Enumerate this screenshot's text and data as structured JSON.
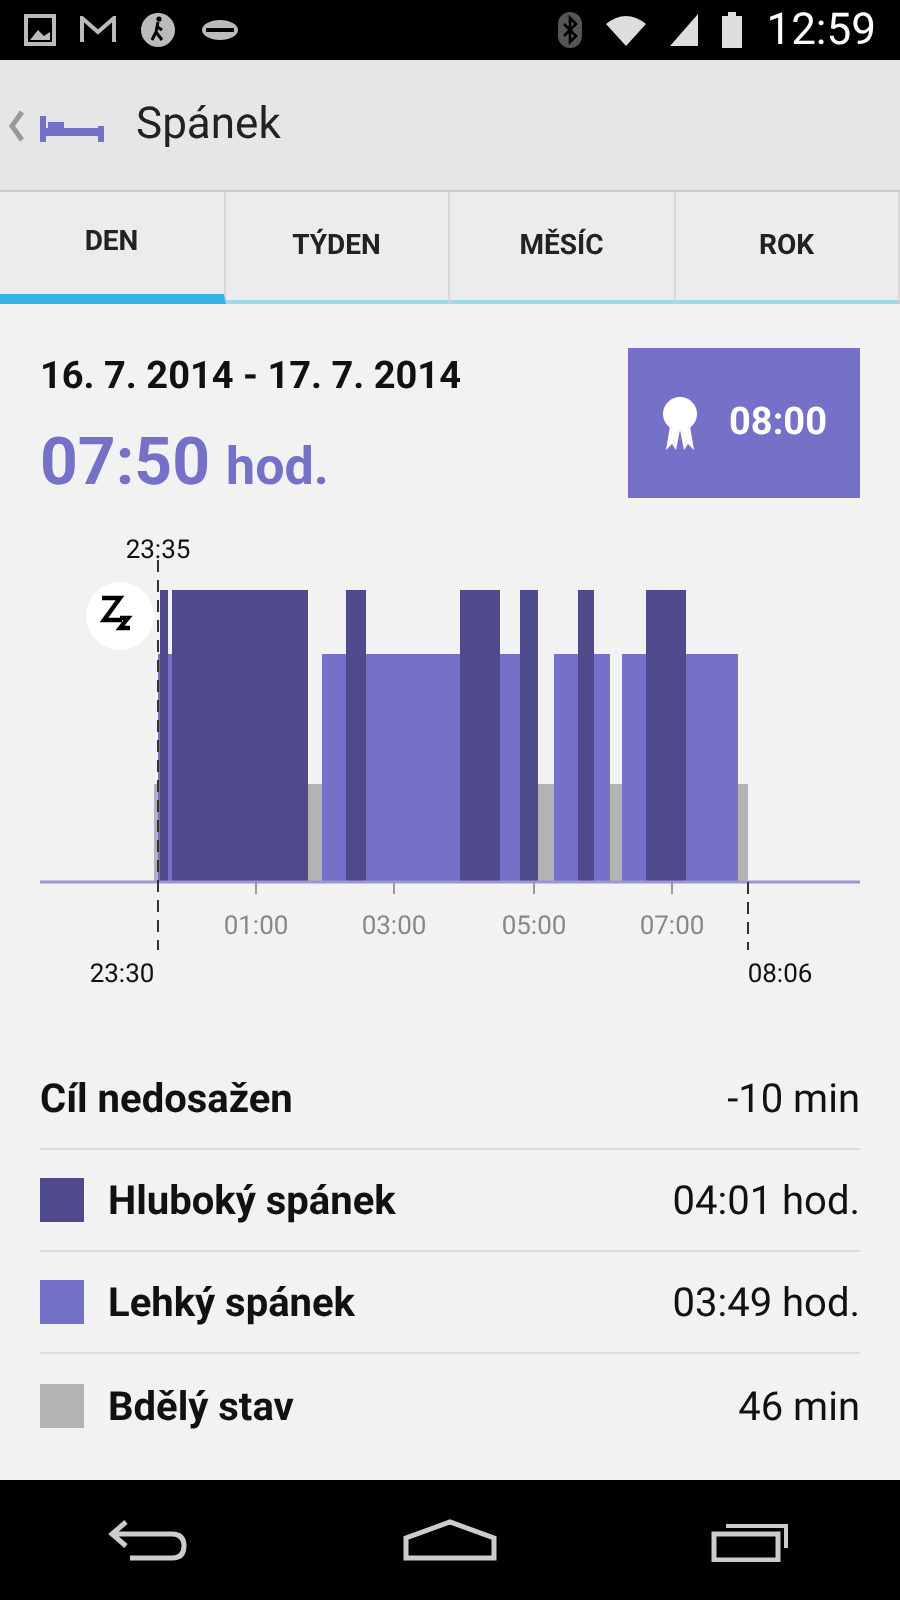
{
  "status_bar": {
    "time": "12:59"
  },
  "app_bar": {
    "title": "Spánek"
  },
  "tabs": [
    {
      "label": "DEN",
      "selected": true
    },
    {
      "label": "TÝDEN",
      "selected": false
    },
    {
      "label": "MĚSÍC",
      "selected": false
    },
    {
      "label": "ROK",
      "selected": false
    }
  ],
  "summary": {
    "date_range": "16. 7. 2014 - 17. 7. 2014",
    "duration": "07:50",
    "duration_unit": "hod.",
    "goal": "08:00"
  },
  "chart": {
    "sleep_start": "23:35",
    "bed_time": "23:30",
    "wake_time": "08:06",
    "ticks": [
      "01:00",
      "03:00",
      "05:00",
      "07:00"
    ]
  },
  "stats": [
    {
      "kind": "goal",
      "label": "Cíl nedosažen",
      "value": "-10 min"
    },
    {
      "kind": "phase",
      "label": "Hluboký spánek",
      "value": "04:01 hod.",
      "color": "#4e4a8c"
    },
    {
      "kind": "phase",
      "label": "Lehký spánek",
      "value": "03:49 hod.",
      "color": "#7571c8"
    },
    {
      "kind": "phase",
      "label": "Bdělý stav",
      "value": "46 min",
      "color": "#b3b3b3"
    }
  ]
}
